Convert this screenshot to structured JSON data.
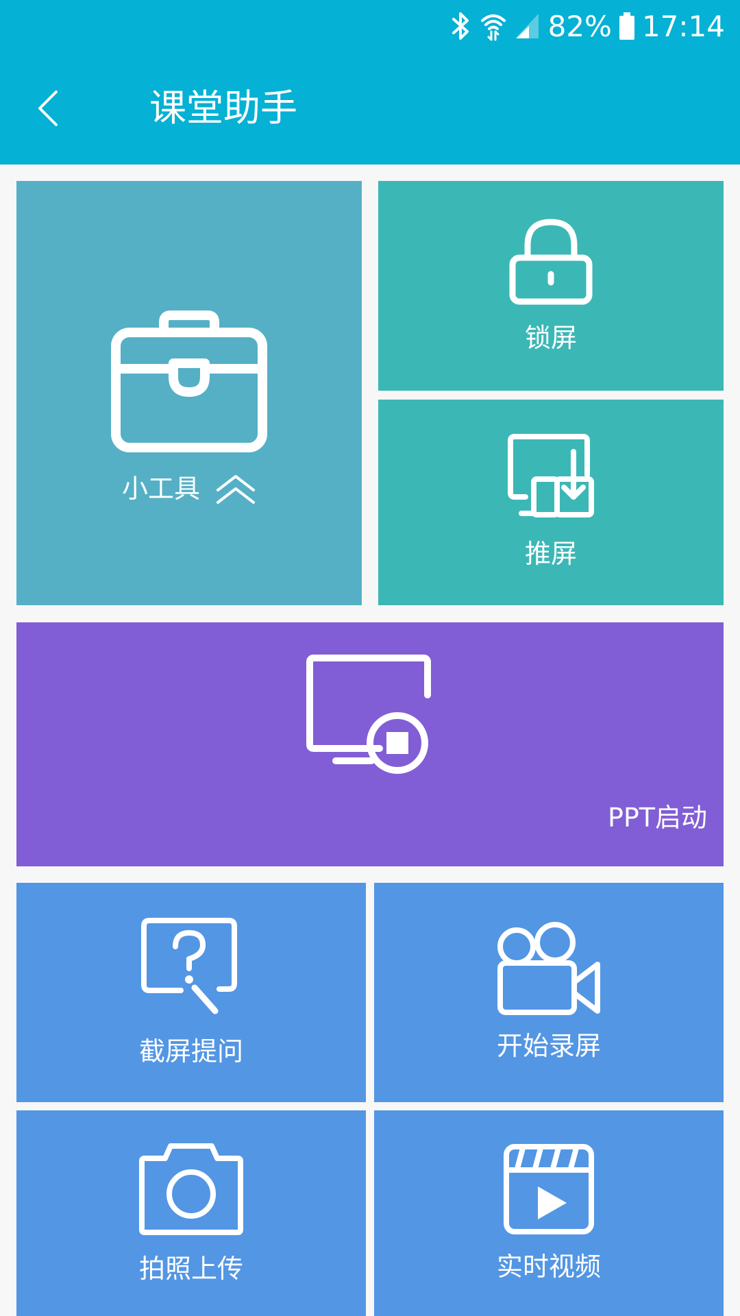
{
  "status_bar": {
    "battery": "82%",
    "time": "17:14",
    "icons": [
      "bluetooth-icon",
      "wifi-icon",
      "signal-icon",
      "battery-icon"
    ]
  },
  "header": {
    "title": "课堂助手",
    "back_icon": "chevron-left-icon"
  },
  "tiles": {
    "tools": {
      "label": "小工具",
      "icon": "toolbox-icon",
      "indicator": "double-chevron-up-icon"
    },
    "lock": {
      "label": "锁屏",
      "icon": "lock-icon"
    },
    "push": {
      "label": "推屏",
      "icon": "push-screen-icon"
    },
    "ppt": {
      "label": "PPT启动",
      "icon": "ppt-screen-icon"
    },
    "screenshot_question": {
      "label": "截屏提问",
      "icon": "question-search-icon"
    },
    "record": {
      "label": "开始录屏",
      "icon": "video-camera-icon"
    },
    "photo": {
      "label": "拍照上传",
      "icon": "camera-icon"
    },
    "live_video": {
      "label": "实时视频",
      "icon": "clapperboard-icon"
    }
  },
  "colors": {
    "appbar": "#05b1d4",
    "tools_tile": "#55b0c6",
    "teal_tile": "#3bb7b6",
    "purple_tile": "#815ed5",
    "blue_tile": "#5396e4",
    "background": "#f7f7f7"
  }
}
